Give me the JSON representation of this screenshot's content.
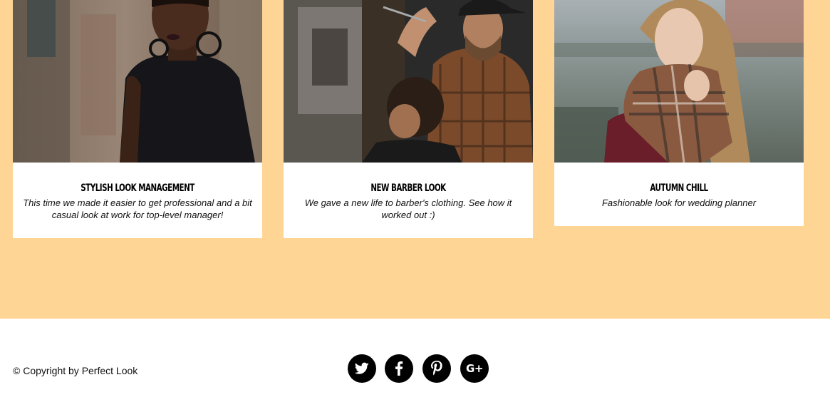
{
  "portfolio": {
    "background": "#ffd596",
    "cards": [
      {
        "title": "Stylish look management",
        "description": "This time we made it easier to get professional and a bit casual look at work for top-level manager!",
        "image": "woman-black-top-photo"
      },
      {
        "title": "New barber look",
        "description": "We gave a new life to barber's clothing. See how it worked out :)",
        "image": "barber-cutting-hair-photo"
      },
      {
        "title": "Autumn chill",
        "description": "Fashionable look for wedding planner",
        "image": "woman-plaid-scarf-photo"
      }
    ]
  },
  "footer": {
    "copyright": "© Copyright by Perfect Look",
    "socials": [
      {
        "name": "twitter",
        "icon": "twitter-icon"
      },
      {
        "name": "facebook",
        "icon": "facebook-icon"
      },
      {
        "name": "pinterest",
        "icon": "pinterest-icon"
      },
      {
        "name": "google-plus",
        "icon": "google-plus-icon",
        "label": "G+"
      }
    ]
  }
}
